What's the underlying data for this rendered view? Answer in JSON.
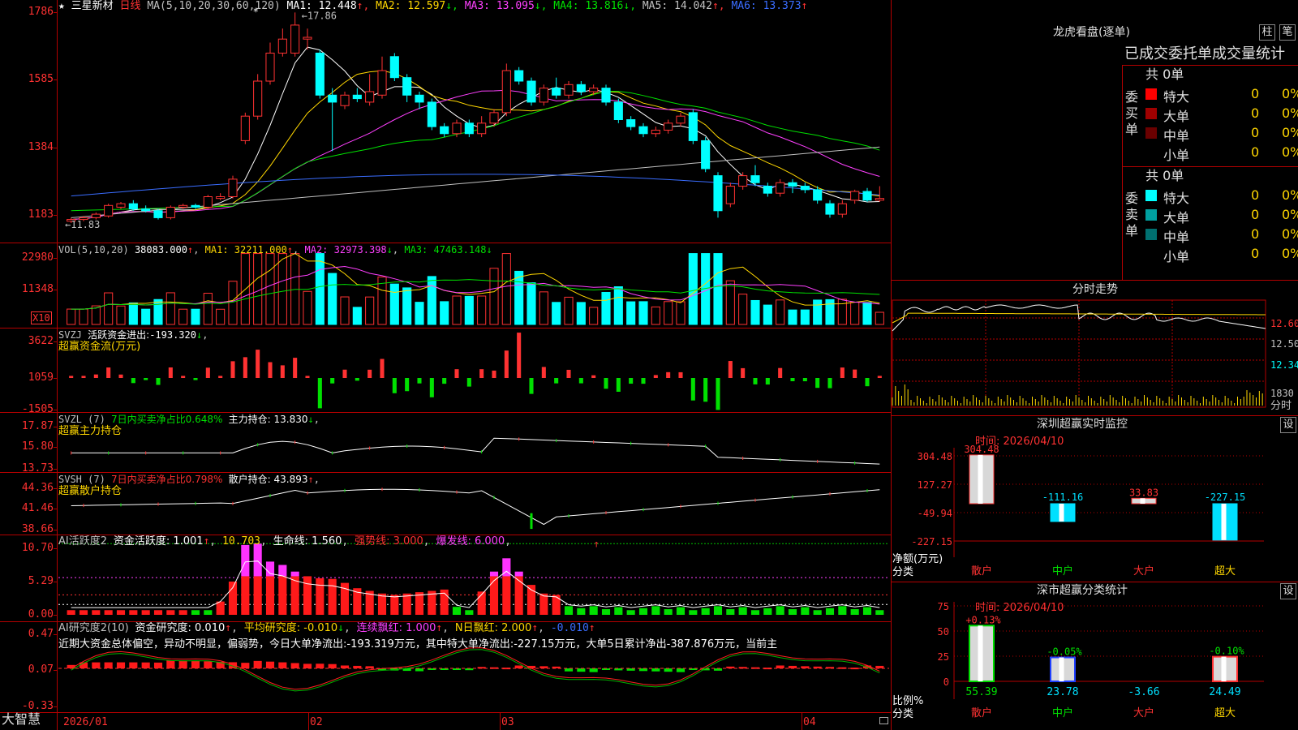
{
  "stock": {
    "star": "★",
    "name": "三星新材",
    "period": "日线"
  },
  "price_panel": {
    "ma_params": "MA(5,10,20,30,60,120)",
    "ma_values": [
      {
        "label": "MA1: 12.448",
        "arrow": "↑",
        "color": "#ffffff"
      },
      {
        "label": "MA2: 12.597",
        "arrow": "↓",
        "color": "#ffd700"
      },
      {
        "label": "MA3: 13.095",
        "arrow": "↓",
        "color": "#ff40ff"
      },
      {
        "label": "MA4: 13.816",
        "arrow": "↓",
        "color": "#00e000"
      },
      {
        "label": "MA5: 14.042",
        "arrow": "↑",
        "color": "#c0c0c0"
      },
      {
        "label": "MA6: 13.373",
        "arrow": "↑",
        "color": "#3a6dff"
      }
    ],
    "y_ticks": [
      "1786",
      "1585",
      "1384",
      "1183"
    ],
    "high_marker": "17.86",
    "low_marker": "11.83",
    "candles": [
      {
        "o": 11.9,
        "c": 11.95,
        "h": 12.0,
        "l": 11.85
      },
      {
        "o": 11.95,
        "c": 12.0,
        "h": 12.05,
        "l": 11.9
      },
      {
        "o": 12.0,
        "c": 12.1,
        "h": 12.15,
        "l": 11.95
      },
      {
        "o": 12.05,
        "c": 12.35,
        "h": 12.4,
        "l": 12.0
      },
      {
        "o": 12.3,
        "c": 12.4,
        "h": 12.45,
        "l": 12.25
      },
      {
        "o": 12.4,
        "c": 12.25,
        "h": 12.5,
        "l": 12.2
      },
      {
        "o": 12.25,
        "c": 12.2,
        "h": 12.35,
        "l": 12.15
      },
      {
        "o": 12.2,
        "c": 12.0,
        "h": 12.25,
        "l": 11.95
      },
      {
        "o": 12.0,
        "c": 12.3,
        "h": 12.35,
        "l": 11.95
      },
      {
        "o": 12.3,
        "c": 12.35,
        "h": 12.4,
        "l": 12.25
      },
      {
        "o": 12.35,
        "c": 12.3,
        "h": 12.4,
        "l": 12.25
      },
      {
        "o": 12.3,
        "c": 12.6,
        "h": 12.65,
        "l": 12.25
      },
      {
        "o": 12.55,
        "c": 12.6,
        "h": 12.7,
        "l": 12.5
      },
      {
        "o": 12.6,
        "c": 13.1,
        "h": 13.2,
        "l": 12.55
      },
      {
        "o": 14.2,
        "c": 14.9,
        "h": 15.0,
        "l": 14.1
      },
      {
        "o": 14.9,
        "c": 15.9,
        "h": 16.1,
        "l": 14.8
      },
      {
        "o": 15.9,
        "c": 16.7,
        "h": 17.0,
        "l": 15.8
      },
      {
        "o": 16.7,
        "c": 17.1,
        "h": 17.4,
        "l": 16.6
      },
      {
        "o": 16.7,
        "c": 17.5,
        "h": 17.86,
        "l": 16.6
      },
      {
        "o": 17.1,
        "c": 17.15,
        "h": 17.4,
        "l": 16.8
      },
      {
        "o": 16.7,
        "c": 15.5,
        "h": 16.8,
        "l": 15.4
      },
      {
        "o": 15.5,
        "c": 15.3,
        "h": 15.7,
        "l": 13.9
      },
      {
        "o": 15.2,
        "c": 15.5,
        "h": 15.6,
        "l": 15.1
      },
      {
        "o": 15.5,
        "c": 15.4,
        "h": 15.7,
        "l": 15.3
      },
      {
        "o": 15.3,
        "c": 15.6,
        "h": 16.1,
        "l": 15.2
      },
      {
        "o": 15.5,
        "c": 16.2,
        "h": 16.6,
        "l": 15.4
      },
      {
        "o": 16.6,
        "c": 16.0,
        "h": 16.7,
        "l": 15.9
      },
      {
        "o": 16.0,
        "c": 15.5,
        "h": 16.1,
        "l": 15.3
      },
      {
        "o": 15.5,
        "c": 15.3,
        "h": 15.6,
        "l": 15.1
      },
      {
        "o": 15.3,
        "c": 14.6,
        "h": 15.4,
        "l": 14.5
      },
      {
        "o": 14.6,
        "c": 14.4,
        "h": 14.7,
        "l": 14.3
      },
      {
        "o": 14.4,
        "c": 14.7,
        "h": 14.8,
        "l": 14.3
      },
      {
        "o": 14.7,
        "c": 14.4,
        "h": 14.8,
        "l": 14.3
      },
      {
        "o": 14.4,
        "c": 14.7,
        "h": 14.9,
        "l": 14.3
      },
      {
        "o": 14.7,
        "c": 15.0,
        "h": 15.1,
        "l": 14.6
      },
      {
        "o": 15.0,
        "c": 16.2,
        "h": 16.4,
        "l": 14.9
      },
      {
        "o": 16.2,
        "c": 15.9,
        "h": 16.3,
        "l": 15.8
      },
      {
        "o": 15.9,
        "c": 15.3,
        "h": 16.0,
        "l": 15.2
      },
      {
        "o": 15.3,
        "c": 15.7,
        "h": 15.8,
        "l": 15.2
      },
      {
        "o": 15.7,
        "c": 15.5,
        "h": 16.0,
        "l": 15.4
      },
      {
        "o": 15.5,
        "c": 15.8,
        "h": 15.9,
        "l": 15.4
      },
      {
        "o": 15.8,
        "c": 15.6,
        "h": 15.9,
        "l": 15.5
      },
      {
        "o": 15.6,
        "c": 15.7,
        "h": 15.8,
        "l": 15.5
      },
      {
        "o": 15.7,
        "c": 15.3,
        "h": 15.8,
        "l": 15.2
      },
      {
        "o": 15.3,
        "c": 14.8,
        "h": 15.4,
        "l": 14.7
      },
      {
        "o": 14.8,
        "c": 14.6,
        "h": 14.9,
        "l": 14.5
      },
      {
        "o": 14.6,
        "c": 14.4,
        "h": 14.7,
        "l": 14.3
      },
      {
        "o": 14.4,
        "c": 14.5,
        "h": 14.6,
        "l": 14.3
      },
      {
        "o": 14.5,
        "c": 14.7,
        "h": 14.8,
        "l": 14.4
      },
      {
        "o": 14.7,
        "c": 14.9,
        "h": 15.0,
        "l": 14.6
      },
      {
        "o": 15.0,
        "c": 14.2,
        "h": 15.1,
        "l": 14.1
      },
      {
        "o": 14.2,
        "c": 13.4,
        "h": 14.3,
        "l": 13.3
      },
      {
        "o": 13.2,
        "c": 12.2,
        "h": 13.3,
        "l": 12.0
      },
      {
        "o": 12.4,
        "c": 12.9,
        "h": 13.0,
        "l": 12.3
      },
      {
        "o": 12.9,
        "c": 13.2,
        "h": 13.3,
        "l": 12.8
      },
      {
        "o": 13.2,
        "c": 13.0,
        "h": 13.5,
        "l": 12.9
      },
      {
        "o": 12.9,
        "c": 12.7,
        "h": 13.0,
        "l": 12.6
      },
      {
        "o": 12.7,
        "c": 13.0,
        "h": 13.1,
        "l": 12.6
      },
      {
        "o": 13.0,
        "c": 12.9,
        "h": 13.1,
        "l": 12.7
      },
      {
        "o": 12.9,
        "c": 12.8,
        "h": 13.0,
        "l": 12.7
      },
      {
        "o": 12.8,
        "c": 12.5,
        "h": 12.9,
        "l": 12.4
      },
      {
        "o": 12.4,
        "c": 12.1,
        "h": 12.5,
        "l": 12.0
      },
      {
        "o": 12.1,
        "c": 12.4,
        "h": 12.5,
        "l": 12.0
      },
      {
        "o": 12.5,
        "c": 12.75,
        "h": 12.8,
        "l": 12.4
      },
      {
        "o": 12.75,
        "c": 12.5,
        "h": 12.85,
        "l": 12.45
      },
      {
        "o": 12.5,
        "c": 12.55,
        "h": 12.9,
        "l": 12.45
      }
    ]
  },
  "vol_panel": {
    "title": "VOL(5,10,20)",
    "value": "38083.000",
    "arrow": "↑",
    "ma1": "MA1: 32211.000",
    "ma1_arrow": "↑",
    "ma2": "MA2: 32973.398",
    "ma2_arrow": "↓",
    "ma3": "MA3: 47463.148",
    "ma3_arrow": "↓",
    "y_ticks": [
      "22980",
      "11348"
    ],
    "x10": "X10"
  },
  "svzj_panel": {
    "label": "SVZJ",
    "desc": "活跃资金进出:",
    "value": "-193.320",
    "arrow": "↓",
    "subtitle": "超赢资金流(万元)",
    "y_ticks": [
      "3622",
      "1059",
      "-1505"
    ]
  },
  "svzl_panel": {
    "label": "SVZL (7)",
    "desc": "7日内买卖净占比0.648%",
    "desc2": "主力持仓: 13.830",
    "arrow": "↓",
    "subtitle": "超赢主力持仓",
    "y_ticks": [
      "17.87",
      "15.80",
      "13.73"
    ]
  },
  "svsh_panel": {
    "label": "SVSH (7)",
    "desc": "7日内买卖净占比0.798%",
    "desc2": "散户持仓: 43.893",
    "arrow": "↑",
    "subtitle": "超赢散户持仓",
    "y_ticks": [
      "44.36",
      "41.46",
      "38.66"
    ]
  },
  "ai_active_panel": {
    "label": "AI活跃度2",
    "desc": "资金活跃度: 1.001",
    "arrow1": "↑",
    "v2": "10.703",
    "v3": "生命线: 1.560",
    "v4": "强势线: 3.000",
    "v5": "爆发线: 6.000",
    "y_ticks": [
      "10.70",
      "5.29",
      "0.00"
    ]
  },
  "ai_research_panel": {
    "label": "AI研究度2(10)",
    "desc": "资金研究度: 0.010",
    "arrow1": "↑",
    "v2": "平均研究度: -0.010",
    "arrow2": "↓",
    "v3": "连续飘红: 1.000",
    "arrow3": "↑",
    "v4": "N日飘红: 2.000",
    "arrow4": "↑",
    "v5": "-0.010",
    "arrow5": "↑",
    "comment": "近期大资金总体偏空，异动不明显，偏弱势，今日大单净流出:-193.319万元，其中特大单净流出:-227.15万元，大单5日累计净出-387.876万元，当前主",
    "y_ticks": [
      "0.47",
      "0.07",
      "-0.33"
    ]
  },
  "x_axis": {
    "brand": "大智慧",
    "labels": [
      "2026/01",
      "02",
      "03",
      "04"
    ]
  },
  "lhb": {
    "title": "龙虎看盘(逐单)",
    "btn1": "柱",
    "btn2": "笔",
    "subtitle": "已成交委托单成交量统计",
    "buy": {
      "side": "委买单",
      "total": "共 0单",
      "rows": [
        {
          "name": "特大",
          "count": "0",
          "pct": "0%",
          "color": "#ff0000"
        },
        {
          "name": "大单",
          "count": "0",
          "pct": "0%",
          "color": "#a00000"
        },
        {
          "name": "中单",
          "count": "0",
          "pct": "0%",
          "color": "#6a0000"
        },
        {
          "name": "小单",
          "count": "0",
          "pct": "0%",
          "color": "#000000"
        }
      ]
    },
    "sell": {
      "side": "委卖单",
      "total": "共 0单",
      "rows": [
        {
          "name": "特大",
          "count": "0",
          "pct": "0%",
          "color": "#00ffff"
        },
        {
          "name": "大单",
          "count": "0",
          "pct": "0%",
          "color": "#00a0a0"
        },
        {
          "name": "中单",
          "count": "0",
          "pct": "0%",
          "color": "#007070"
        },
        {
          "name": "小单",
          "count": "0",
          "pct": "0%",
          "color": "#000000"
        }
      ]
    }
  },
  "fenshi": {
    "title": "分时走势",
    "y_ticks": [
      "12.60",
      "12.50",
      "12.34"
    ],
    "vol_tick": "1830",
    "unit": "分时"
  },
  "monitor": {
    "title": "深圳超赢实时监控",
    "set_btn": "设",
    "time": "时间: 2026/04/10",
    "y_ticks": [
      "304.48",
      "127.27",
      "-49.94",
      "-227.15"
    ],
    "ylabel": "净额(万元)",
    "xlabel": "分类",
    "bars": [
      {
        "cat": "散户",
        "value": 304.48,
        "label": "304.48",
        "color": "#ff3232",
        "fill": "#d8d8d8"
      },
      {
        "cat": "中户",
        "value": -111.16,
        "label": "-111.16",
        "color": "#00e0ff",
        "fill": "#00e0ff"
      },
      {
        "cat": "大户",
        "value": 33.83,
        "label": "33.83",
        "color": "#ff3232",
        "fill": "#d8d8d8"
      },
      {
        "cat": "超大",
        "value": -227.15,
        "label": "-227.15",
        "color": "#00e0ff",
        "fill": "#00e0ff"
      }
    ]
  },
  "classify": {
    "title": "深市超赢分类统计",
    "set_btn": "设",
    "time": "时间: 2026/04/10",
    "y_ticks": [
      "75",
      "50",
      "25",
      "0"
    ],
    "ylabel": "比例%",
    "xlabel": "分类",
    "bars": [
      {
        "cat": "散户",
        "pct_label": "+0.13%",
        "value": 55.39,
        "val_label": "55.39",
        "edge": "#00e000",
        "pct_color": "#ff3232"
      },
      {
        "cat": "中户",
        "pct_label": "-0.05%",
        "value": 23.78,
        "val_label": "23.78",
        "edge": "#2040ff",
        "pct_color": "#00e000"
      },
      {
        "cat": "大户",
        "pct_label": "",
        "value": -3.66,
        "val_label": "-3.66",
        "edge": "#00e0ff",
        "pct_color": "#00e000"
      },
      {
        "cat": "超大",
        "pct_label": "-0.10%",
        "value": 24.49,
        "val_label": "24.49",
        "edge": "#ff3232",
        "pct_color": "#00e000"
      }
    ]
  }
}
